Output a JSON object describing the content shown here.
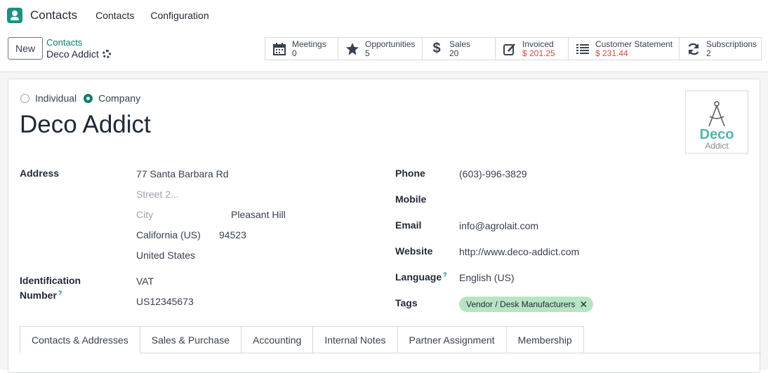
{
  "nav": {
    "app": "Contacts",
    "items": [
      "Contacts",
      "Configuration"
    ]
  },
  "control": {
    "new_label": "New",
    "breadcrumb_parent": "Contacts",
    "breadcrumb_current": "Deco Addict"
  },
  "stats": [
    {
      "icon": "calendar-icon",
      "label": "Meetings",
      "value": "0",
      "red": false
    },
    {
      "icon": "star-icon",
      "label": "Opportunities",
      "value": "5",
      "red": false
    },
    {
      "icon": "dollar-icon",
      "label": "Sales",
      "value": "20",
      "red": false
    },
    {
      "icon": "invoice-icon",
      "label": "Invoiced",
      "value": "$ 201.25",
      "red": true
    },
    {
      "icon": "list-icon",
      "label": "Customer Statement",
      "value": "$ 231.44",
      "red": true
    },
    {
      "icon": "refresh-icon",
      "label": "Subscriptions",
      "value": "2",
      "red": false
    }
  ],
  "form": {
    "radio_individual": "Individual",
    "radio_company": "Company",
    "company_type": "Company",
    "name": "Deco Addict",
    "logo": {
      "big": "Deco",
      "small": "Addict"
    },
    "address_label": "Address",
    "street": "77 Santa Barbara Rd",
    "street2_placeholder": "Street 2...",
    "city_placeholder": "City",
    "city": "Pleasant Hill",
    "state": "California (US)",
    "zip": "94523",
    "country": "United States",
    "id_label_line1": "Identification",
    "id_label_line2": "Number",
    "id_help": "?",
    "id_type": "VAT",
    "id_value": "US12345673",
    "phone_label": "Phone",
    "phone": "(603)-996-3829",
    "mobile_label": "Mobile",
    "email_label": "Email",
    "email": "info@agrolait.com",
    "website_label": "Website",
    "website": "http://www.deco-addict.com",
    "language_label": "Language",
    "language_help": "?",
    "language": "English (US)",
    "tags_label": "Tags",
    "tag": "Vendor / Desk Manufacturers"
  },
  "tabs": [
    "Contacts & Addresses",
    "Sales & Purchase",
    "Accounting",
    "Internal Notes",
    "Partner Assignment",
    "Membership"
  ]
}
